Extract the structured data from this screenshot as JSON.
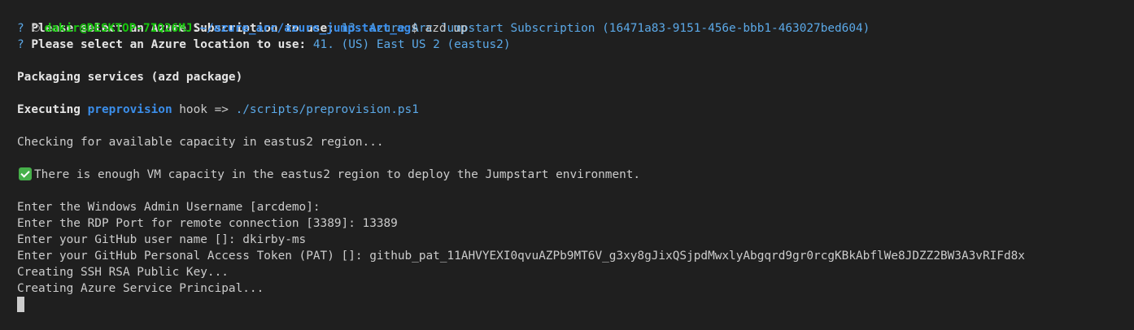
{
  "prompt": {
    "user_host": "dakir@DESKTOP-7IQ26MJ",
    "separator": ":",
    "path": "~/azure_arc/azure_jumpstart_ag",
    "symbol": "$",
    "command": " azd up"
  },
  "subscription": {
    "marker": "? ",
    "label": "Please select an Azure Subscription to use: ",
    "value": "13. Azure Arc Jumpstart Subscription (16471a83-9151-456e-bbb1-463027bed604)"
  },
  "location": {
    "marker": "? ",
    "label": "Please select an Azure location to use: ",
    "value": "41. (US) East US 2 (eastus2)"
  },
  "packaging": "Packaging services (azd package)",
  "executing": {
    "label": "Executing ",
    "hook_name": "preprovision",
    "arrow": " hook => ",
    "script": "./scripts/preprovision.ps1"
  },
  "checking": "Checking for available capacity in eastus2 region...",
  "capacity_ok": {
    "icon": "check-mark-icon",
    "text": "There is enough VM capacity in the eastus2 region to deploy the Jumpstart environment."
  },
  "inputs": [
    {
      "prompt": "Enter the Windows Admin Username [arcdemo]:",
      "value": ""
    },
    {
      "prompt": "Enter the RDP Port for remote connection [3389]: ",
      "value": "13389"
    },
    {
      "prompt": "Enter your GitHub user name []: ",
      "value": "dkirby-ms"
    },
    {
      "prompt": "Enter your GitHub Personal Access Token (PAT) []: ",
      "value": "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"
    }
  ],
  "status_lines": [
    "Creating SSH RSA Public Key...",
    "Creating Azure Service Principal..."
  ],
  "colors": {
    "background": "#1f1f1f",
    "prompt_green": "#16c60c",
    "path_blue": "#3b8eea",
    "value_cyan": "#5ba9e8",
    "check_green": "#46b04a"
  }
}
